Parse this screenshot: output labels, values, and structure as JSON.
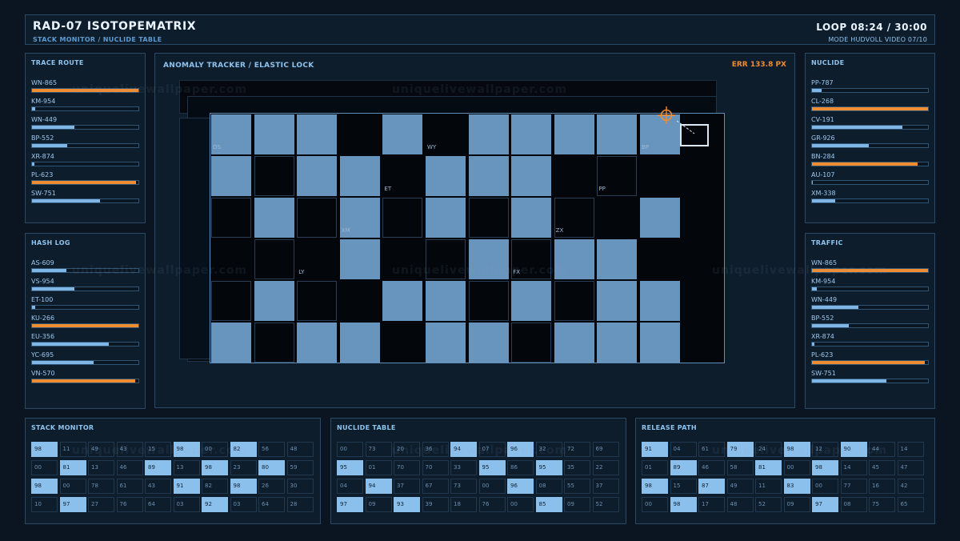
{
  "header": {
    "title": "RAD-07  ISOTOPEMATRIX",
    "subtitle": "STACK MONITOR / NUCLIDE TABLE",
    "loop": "LOOP 08:24 / 30:00",
    "mode": "MODE HUDVOLL  VIDEO 07/10"
  },
  "watermark": "uniquelivewallpaper.com",
  "trace_route": {
    "title": "TRACE ROUTE",
    "items": [
      {
        "label": "WN-865",
        "value": 1.0,
        "hot": true
      },
      {
        "label": "KM-954",
        "value": 0.03,
        "hot": false
      },
      {
        "label": "WN-449",
        "value": 0.4,
        "hot": false
      },
      {
        "label": "BP-552",
        "value": 0.33,
        "hot": false
      },
      {
        "label": "XR-874",
        "value": 0.02,
        "hot": false
      },
      {
        "label": "PL-623",
        "value": 0.98,
        "hot": true
      },
      {
        "label": "SW-751",
        "value": 0.64,
        "hot": false
      }
    ]
  },
  "hash_log": {
    "title": "HASH LOG",
    "items": [
      {
        "label": "AS-609",
        "value": 0.32,
        "hot": false
      },
      {
        "label": "VS-954",
        "value": 0.4,
        "hot": false
      },
      {
        "label": "ET-100",
        "value": 0.03,
        "hot": false
      },
      {
        "label": "KU-266",
        "value": 1.0,
        "hot": true
      },
      {
        "label": "EU-356",
        "value": 0.72,
        "hot": false
      },
      {
        "label": "YC-695",
        "value": 0.58,
        "hot": false
      },
      {
        "label": "VN-570",
        "value": 0.97,
        "hot": true
      }
    ]
  },
  "nuclide": {
    "title": "NUCLIDE",
    "items": [
      {
        "label": "PP-787",
        "value": 0.08,
        "hot": false
      },
      {
        "label": "CL-268",
        "value": 1.0,
        "hot": true
      },
      {
        "label": "CV-191",
        "value": 0.78,
        "hot": false
      },
      {
        "label": "GR-926",
        "value": 0.49,
        "hot": false
      },
      {
        "label": "BN-284",
        "value": 0.91,
        "hot": true
      },
      {
        "label": "AU-107",
        "value": 0.01,
        "hot": false
      },
      {
        "label": "XM-338",
        "value": 0.2,
        "hot": false
      }
    ]
  },
  "traffic": {
    "title": "TRAFFIC",
    "items": [
      {
        "label": "WN-865",
        "value": 1.0,
        "hot": true
      },
      {
        "label": "KM-954",
        "value": 0.04,
        "hot": false
      },
      {
        "label": "WN-449",
        "value": 0.4,
        "hot": false
      },
      {
        "label": "BP-552",
        "value": 0.32,
        "hot": false
      },
      {
        "label": "XR-874",
        "value": 0.02,
        "hot": false
      },
      {
        "label": "PL-623",
        "value": 0.97,
        "hot": true
      },
      {
        "label": "SW-751",
        "value": 0.64,
        "hot": false
      }
    ]
  },
  "tracker": {
    "title": "ANOMALY TRACKER / ELASTIC LOCK",
    "err": "ERR  133.8 PX",
    "rows": [
      "LLL.L.LLLLL",
      "L.LL.LLL...",
      ".L.L.L.L..L",
      "...L..L.LL.",
      ".L..LL.L.LL",
      "L.LL.LL.LLL"
    ],
    "tags": [
      {
        "text": "OS",
        "row": 0,
        "col": 0
      },
      {
        "text": "WY",
        "row": 0,
        "col": 5
      },
      {
        "text": "BP",
        "row": 0,
        "col": 10
      },
      {
        "text": "ET",
        "row": 1,
        "col": 4
      },
      {
        "text": "PP",
        "row": 1,
        "col": 9
      },
      {
        "text": "XM",
        "row": 2,
        "col": 3
      },
      {
        "text": "ZX",
        "row": 2,
        "col": 8
      },
      {
        "text": "LY",
        "row": 3,
        "col": 2
      },
      {
        "text": "FX",
        "row": 3,
        "col": 7
      }
    ]
  },
  "stack_monitor": {
    "title": "STACK MONITOR",
    "rows": [
      [
        "98",
        "11",
        "49",
        "43",
        "15",
        "98",
        "00",
        "82",
        "56",
        "48"
      ],
      [
        "00",
        "81",
        "13",
        "46",
        "89",
        "13",
        "98",
        "23",
        "80",
        "59"
      ],
      [
        "98",
        "00",
        "78",
        "61",
        "43",
        "91",
        "82",
        "98",
        "26",
        "30"
      ],
      [
        "10",
        "97",
        "27",
        "76",
        "64",
        "03",
        "92",
        "03",
        "64",
        "28"
      ]
    ],
    "lit": [
      [
        0,
        0
      ],
      [
        0,
        5
      ],
      [
        0,
        7
      ],
      [
        1,
        1
      ],
      [
        1,
        4
      ],
      [
        1,
        6
      ],
      [
        1,
        8
      ],
      [
        2,
        0
      ],
      [
        2,
        5
      ],
      [
        2,
        7
      ],
      [
        3,
        1
      ],
      [
        3,
        6
      ]
    ]
  },
  "nuclide_table": {
    "title": "NUCLIDE TABLE",
    "rows": [
      [
        "00",
        "73",
        "20",
        "36",
        "94",
        "07",
        "96",
        "32",
        "72",
        "69"
      ],
      [
        "95",
        "01",
        "70",
        "70",
        "33",
        "95",
        "86",
        "95",
        "35",
        "22"
      ],
      [
        "04",
        "94",
        "37",
        "67",
        "73",
        "00",
        "96",
        "08",
        "55",
        "37"
      ],
      [
        "97",
        "09",
        "93",
        "39",
        "18",
        "76",
        "00",
        "85",
        "09",
        "52"
      ]
    ],
    "lit": [
      [
        0,
        4
      ],
      [
        0,
        6
      ],
      [
        1,
        0
      ],
      [
        1,
        5
      ],
      [
        1,
        7
      ],
      [
        2,
        1
      ],
      [
        2,
        6
      ],
      [
        3,
        0
      ],
      [
        3,
        2
      ],
      [
        3,
        7
      ]
    ]
  },
  "release_path": {
    "title": "RELEASE PATH",
    "rows": [
      [
        "91",
        "04",
        "61",
        "79",
        "24",
        "98",
        "12",
        "90",
        "44",
        "14"
      ],
      [
        "01",
        "89",
        "46",
        "58",
        "81",
        "00",
        "98",
        "14",
        "45",
        "47"
      ],
      [
        "98",
        "15",
        "87",
        "49",
        "11",
        "83",
        "00",
        "77",
        "16",
        "42"
      ],
      [
        "00",
        "98",
        "17",
        "48",
        "52",
        "09",
        "97",
        "08",
        "75",
        "65"
      ]
    ],
    "lit": [
      [
        0,
        0
      ],
      [
        0,
        3
      ],
      [
        0,
        5
      ],
      [
        0,
        7
      ],
      [
        1,
        1
      ],
      [
        1,
        4
      ],
      [
        1,
        6
      ],
      [
        2,
        0
      ],
      [
        2,
        2
      ],
      [
        2,
        5
      ],
      [
        3,
        1
      ],
      [
        3,
        6
      ]
    ]
  }
}
